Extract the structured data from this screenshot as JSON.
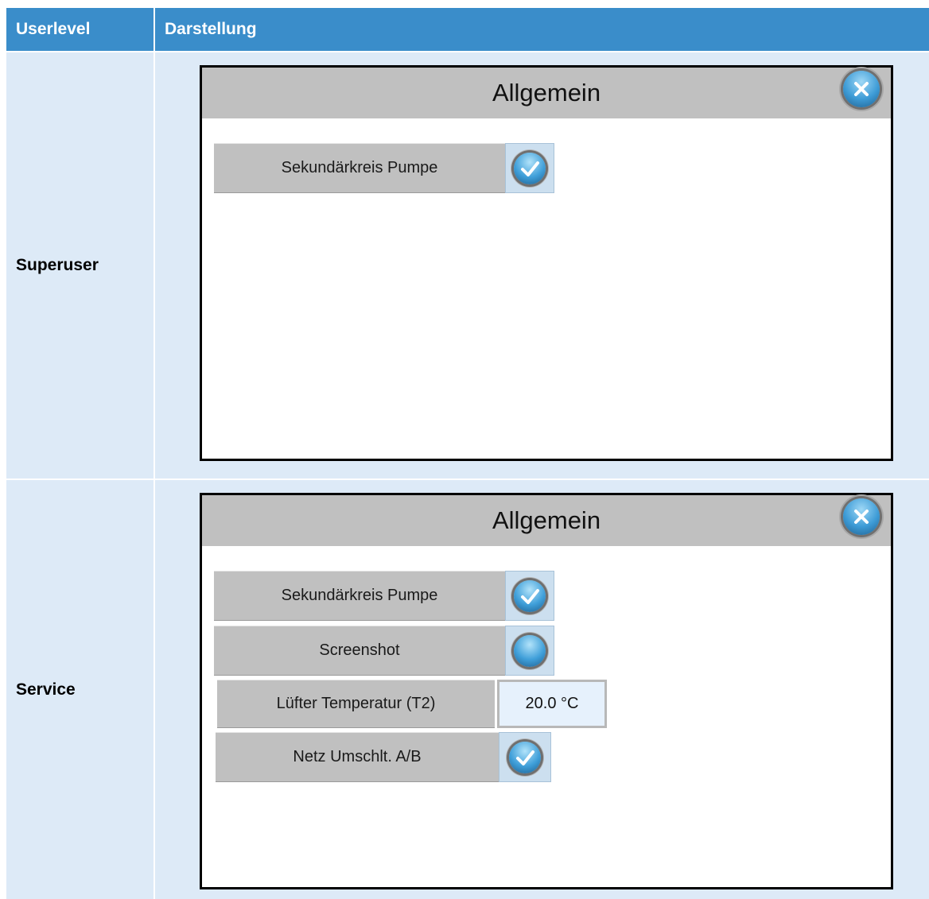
{
  "header": {
    "col1": "Userlevel",
    "col2": "Darstellung"
  },
  "rows": [
    {
      "level": "Superuser",
      "panel": {
        "title": "Allgemein",
        "close_icon": "close-icon",
        "options": [
          {
            "label": "Sekundärkreis Pumpe",
            "state": "checked"
          }
        ]
      }
    },
    {
      "level": "Service",
      "panel": {
        "title": "Allgemein",
        "close_icon": "close-icon",
        "options": [
          {
            "label": "Sekundärkreis Pumpe",
            "state": "checked"
          },
          {
            "label": "Screenshot",
            "state": "unchecked"
          },
          {
            "label": "Lüfter Temperatur (T2)",
            "value": "20.0 °C"
          },
          {
            "label": "Netz Umschlt. A/B",
            "state": "checked"
          }
        ]
      }
    }
  ],
  "colors": {
    "header_bg": "#3a8dca",
    "row_bg": "#ddeaf7",
    "panel_title_bg": "#c0c0c0"
  }
}
